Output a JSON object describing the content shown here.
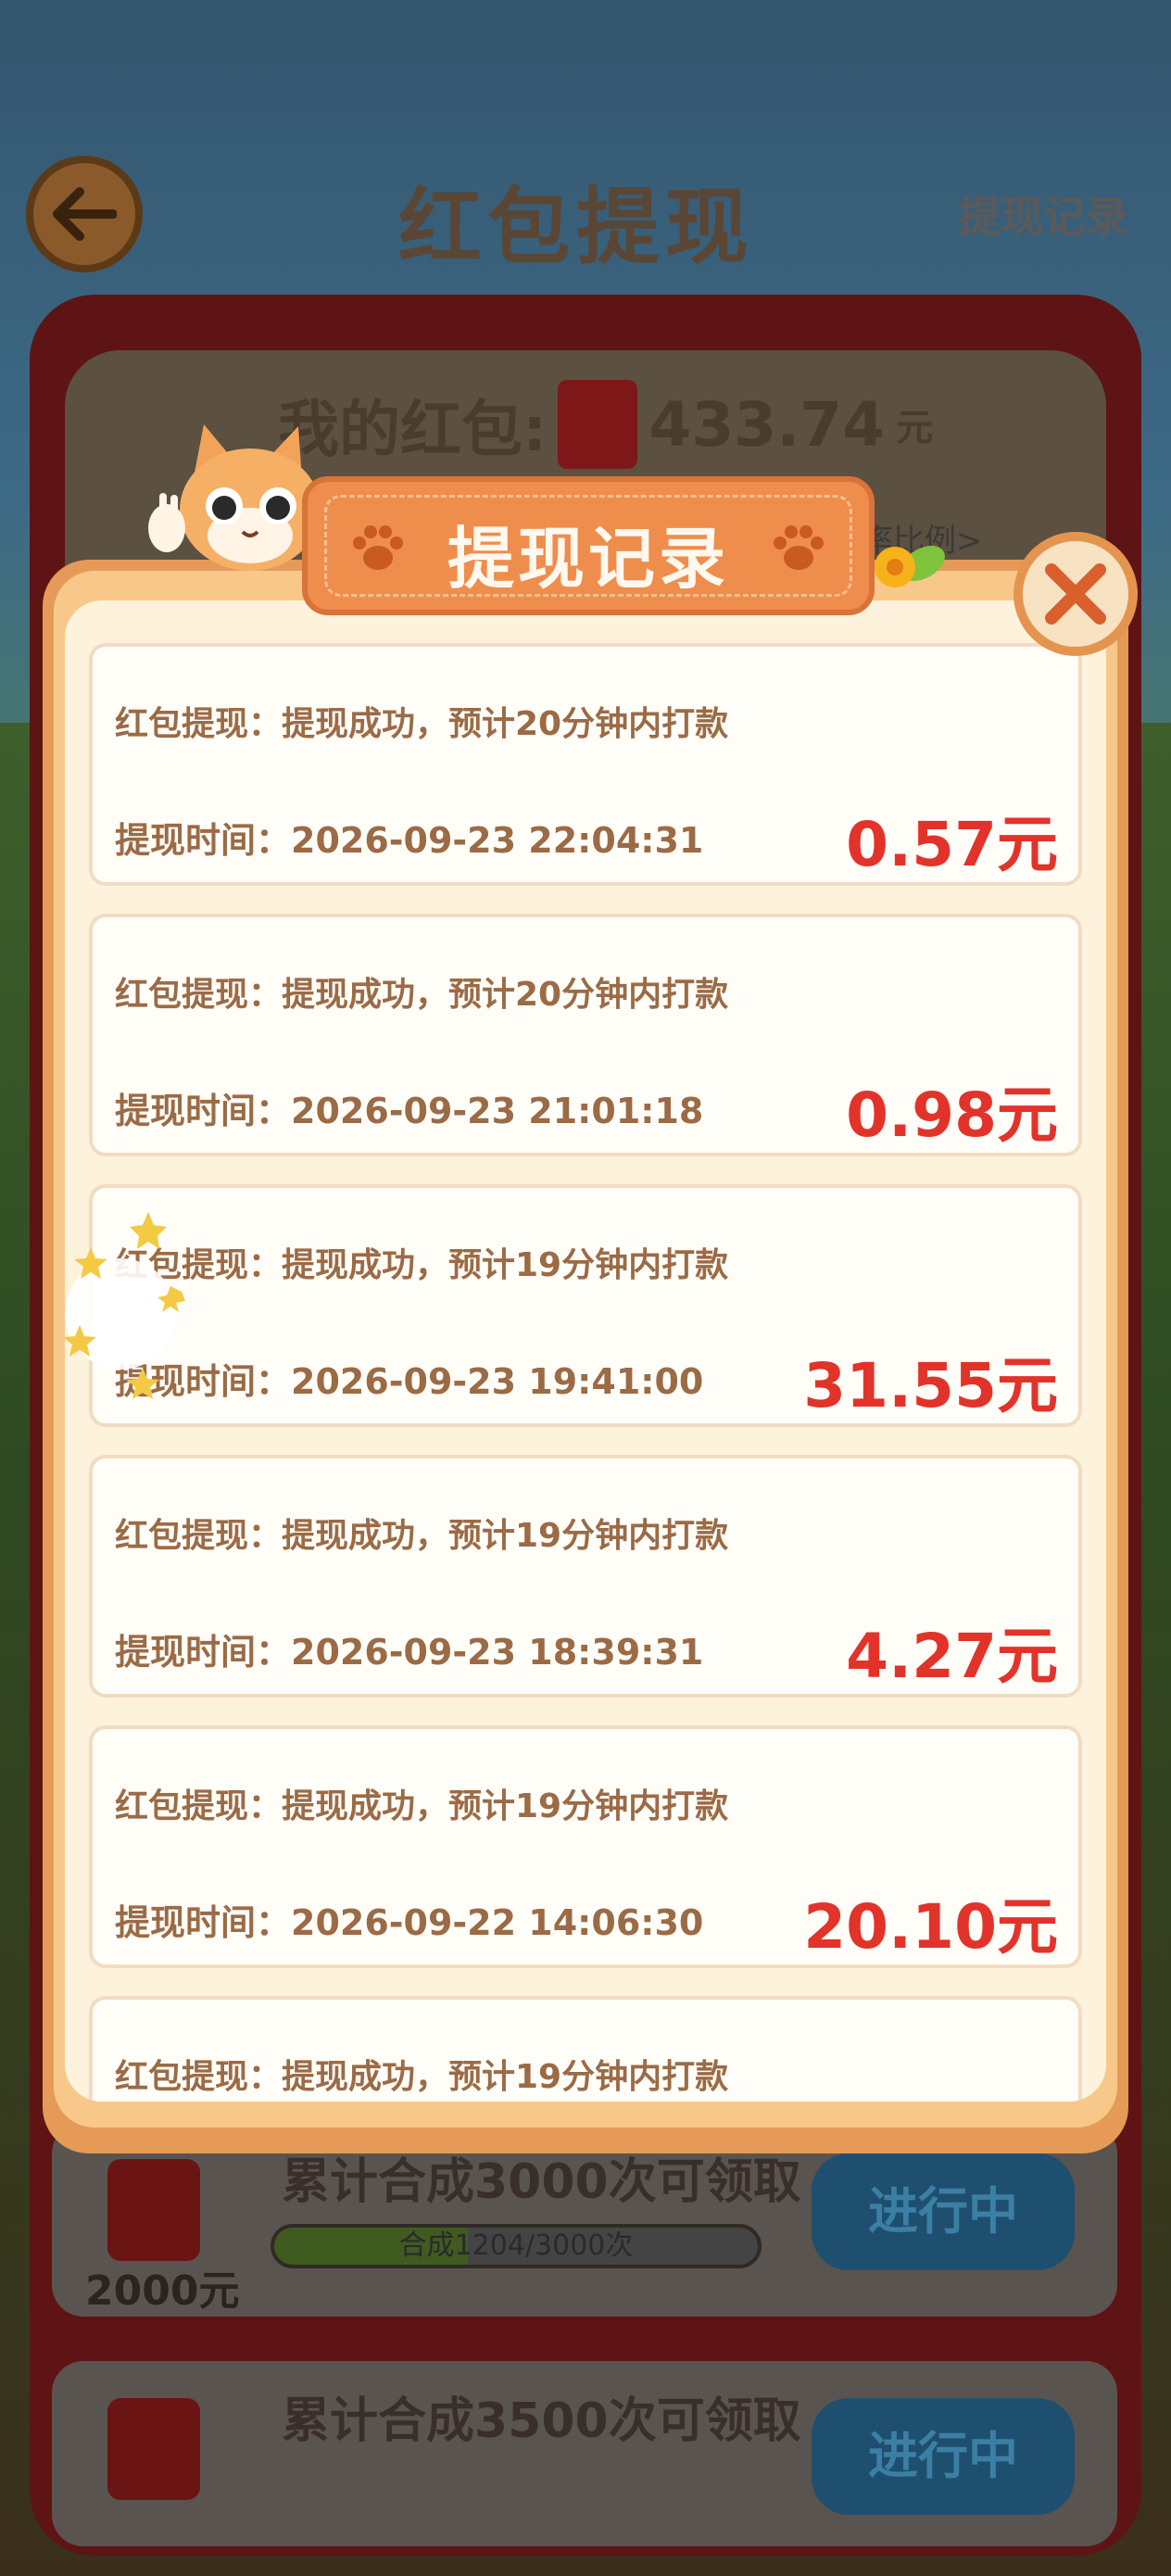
{
  "page": {
    "title": "红包提现",
    "history_link": "提现记录",
    "balance_label": "我的红包:",
    "balance_value": "433.74",
    "balance_unit": "元",
    "rate_link": "率比例>"
  },
  "tasks": [
    {
      "reward": "2000元",
      "name": "累计合成3000次可领取",
      "progress_text": "合成1204/3000次",
      "progress": 0.401,
      "button": "进行中"
    },
    {
      "reward": "",
      "name": "累计合成3500次可领取",
      "progress_text": "",
      "progress": 0,
      "button": "进行中"
    }
  ],
  "modal": {
    "title": "提现记录",
    "records": [
      {
        "status": "红包提现：提现成功，预计20分钟内打款",
        "time": "提现时间：2026-09-23 22:04:31",
        "amount": "0.57元"
      },
      {
        "status": "红包提现：提现成功，预计20分钟内打款",
        "time": "提现时间：2026-09-23 21:01:18",
        "amount": "0.98元"
      },
      {
        "status": "红包提现：提现成功，预计19分钟内打款",
        "time": "提现时间：2026-09-23 19:41:00",
        "amount": "31.55元"
      },
      {
        "status": "红包提现：提现成功，预计19分钟内打款",
        "time": "提现时间：2026-09-23 18:39:31",
        "amount": "4.27元"
      },
      {
        "status": "红包提现：提现成功，预计19分钟内打款",
        "time": "提现时间：2026-09-22 14:06:30",
        "amount": "20.10元"
      },
      {
        "status": "红包提现：提现成功，预计19分钟内打款",
        "time": "",
        "amount": ""
      }
    ]
  },
  "colors": {
    "accent_orange": "#ef8d4c",
    "amount_red": "#e2332a",
    "record_text": "#9b6b46",
    "modal_bg": "#fdf2dc"
  },
  "icons": {
    "back": "arrow-left-icon",
    "close": "close-x-icon",
    "paw": "paw-icon",
    "red_packet": "red-packet-icon"
  }
}
